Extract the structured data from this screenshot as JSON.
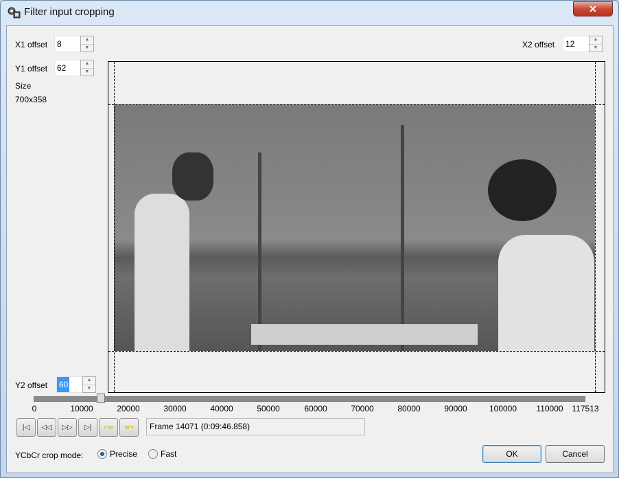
{
  "window": {
    "title": "Filter input cropping",
    "close_label": "✕"
  },
  "offsets": {
    "x1": {
      "label": "X1 offset",
      "value": "8"
    },
    "y1": {
      "label": "Y1 offset",
      "value": "62"
    },
    "x2": {
      "label": "X2 offset",
      "value": "12"
    },
    "y2": {
      "label": "Y2 offset",
      "value": "60"
    }
  },
  "size": {
    "label": "Size",
    "value": "700x358"
  },
  "timeline": {
    "ticks": [
      "0",
      "10000",
      "20000",
      "30000",
      "40000",
      "50000",
      "60000",
      "70000",
      "80000",
      "90000",
      "100000",
      "110000",
      "117513"
    ],
    "position": 14071,
    "max": 117513
  },
  "transport": [
    "start",
    "prev-key",
    "next-key",
    "end",
    "mark-in",
    "mark-out"
  ],
  "status": "Frame 14071 (0:09:46.858)",
  "crop_mode": {
    "label": "YCbCr crop mode:",
    "options": [
      {
        "label": "Precise",
        "selected": true
      },
      {
        "label": "Fast",
        "selected": false
      }
    ]
  },
  "buttons": {
    "ok": "OK",
    "cancel": "Cancel"
  }
}
